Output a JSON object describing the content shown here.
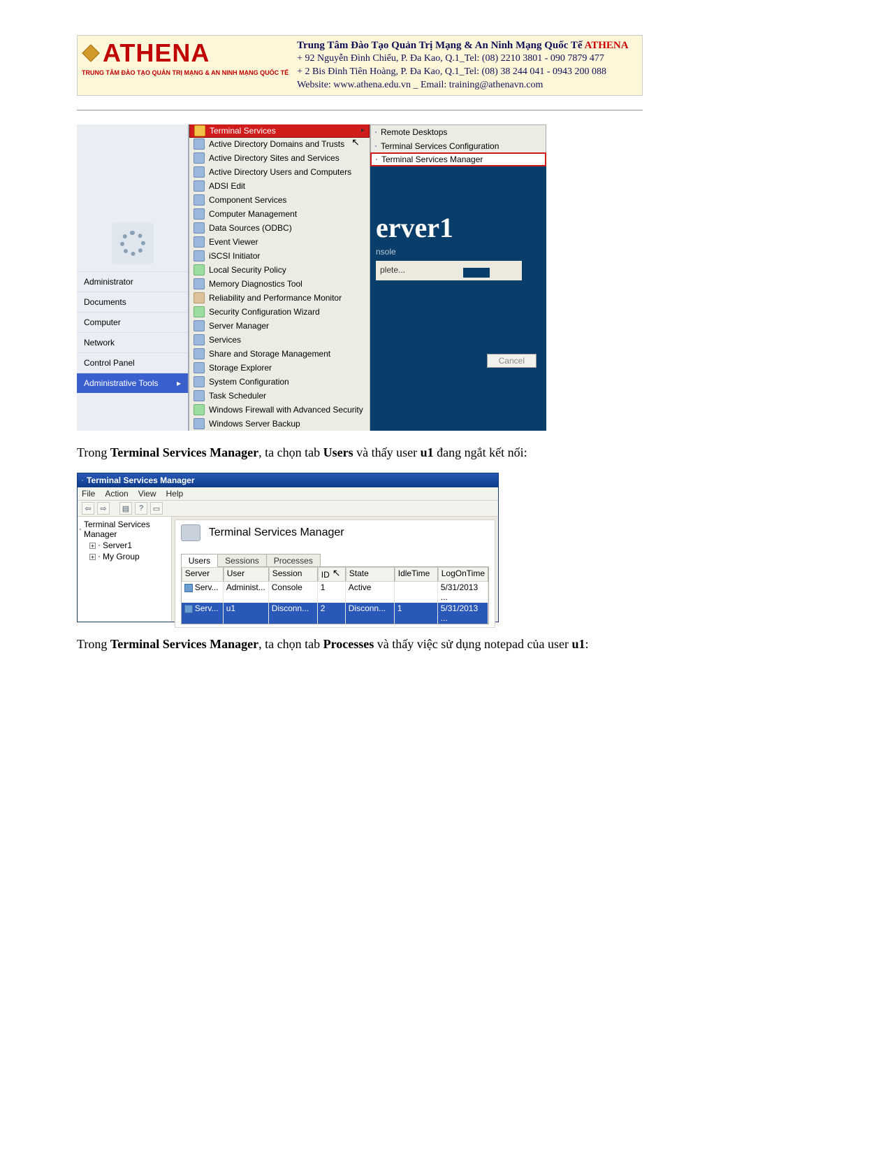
{
  "banner": {
    "brand": "ATHENA",
    "slogan": "TRUNG TÂM ĐÀO TẠO QUẢN TRỊ MẠNG & AN NINH MẠNG QUỐC TẾ",
    "title_main": "Trung Tâm Đào Tạo Quản Trị Mạng & An Ninh Mạng Quốc Tế ",
    "title_brand": "ATHENA",
    "addr1": "+  92 Nguyễn Đình Chiểu, P. Đa Kao, Q.1_Tel: (08) 2210 3801 -  090 7879 477",
    "addr2": "+  2 Bis Đinh Tiên Hoàng, P. Đa Kao, Q.1_Tel: (08) 38 244 041 - 0943 200 088",
    "web": "Website:  www.athena.edu.vn     _        Email: training@athenavn.com"
  },
  "start_left": {
    "items": [
      "Administrator",
      "Documents",
      "Computer",
      "Network",
      "Control Panel"
    ],
    "selected": "Administrative Tools"
  },
  "start_mid": [
    {
      "label": "Terminal Services",
      "hl": true,
      "arrow": true,
      "ico": "folder"
    },
    {
      "label": "Active Directory Domains and Trusts",
      "ico": "gen"
    },
    {
      "label": "Active Directory Sites and Services",
      "ico": "gen"
    },
    {
      "label": "Active Directory Users and Computers",
      "ico": "gen"
    },
    {
      "label": "ADSI Edit",
      "ico": "gen"
    },
    {
      "label": "Component Services",
      "ico": "gen"
    },
    {
      "label": "Computer Management",
      "ico": "gen"
    },
    {
      "label": "Data Sources (ODBC)",
      "ico": "gen"
    },
    {
      "label": "Event Viewer",
      "ico": "gen"
    },
    {
      "label": "iSCSI Initiator",
      "ico": "gen"
    },
    {
      "label": "Local Security Policy",
      "ico": "sec"
    },
    {
      "label": "Memory Diagnostics Tool",
      "ico": "gen"
    },
    {
      "label": "Reliability and Performance Monitor",
      "ico": "rel"
    },
    {
      "label": "Security Configuration Wizard",
      "ico": "sec"
    },
    {
      "label": "Server Manager",
      "ico": "gen"
    },
    {
      "label": "Services",
      "ico": "gen"
    },
    {
      "label": "Share and Storage Management",
      "ico": "gen"
    },
    {
      "label": "Storage Explorer",
      "ico": "gen"
    },
    {
      "label": "System Configuration",
      "ico": "gen"
    },
    {
      "label": "Task Scheduler",
      "ico": "gen"
    },
    {
      "label": "Windows Firewall with Advanced Security",
      "ico": "sec"
    },
    {
      "label": "Windows Server Backup",
      "ico": "gen"
    }
  ],
  "start_right": {
    "submenu": [
      {
        "label": "Remote Desktops"
      },
      {
        "label": "Terminal Services Configuration"
      },
      {
        "label": "Terminal Services Manager",
        "hl": true
      }
    ],
    "server": "erver1",
    "nsole": "nsole",
    "plete": "plete...",
    "cancel": "Cancel"
  },
  "para1": {
    "p1": "Trong ",
    "b1": "Terminal Services Manager",
    "p2": ", ta chọn tab ",
    "b2": "Users",
    "p3": " và thấy user ",
    "b3": "u1",
    "p4": " đang ngắt kết nối:"
  },
  "tsm": {
    "title": "Terminal Services Manager",
    "menu": [
      "File",
      "Action",
      "View",
      "Help"
    ],
    "tree_root": "Terminal Services Manager",
    "tree_server": "Server1",
    "tree_group": "My Group",
    "header_title": "Terminal Services Manager",
    "tabs": [
      "Users",
      "Sessions",
      "Processes"
    ],
    "columns": [
      "Server",
      "User",
      "Session",
      "ID",
      "State",
      "IdleTime",
      "LogOnTime"
    ],
    "rows": [
      {
        "server": "Serv...",
        "user": "Administ...",
        "session": "Console",
        "id": "1",
        "state": "Active",
        "idle": "",
        "log": "5/31/2013 ...",
        "sel": false
      },
      {
        "server": "Serv...",
        "user": "u1",
        "session": "Disconn...",
        "id": "2",
        "state": "Disconn...",
        "idle": "1",
        "log": "5/31/2013 ...",
        "sel": true
      }
    ]
  },
  "para2": {
    "p1": "Trong ",
    "b1": "Terminal Services Manager",
    "p2": ", ta chọn tab ",
    "b2": "Processes",
    "p3": " và thấy việc sử dụng notepad của user ",
    "b3": "u1",
    "p4": ":"
  }
}
